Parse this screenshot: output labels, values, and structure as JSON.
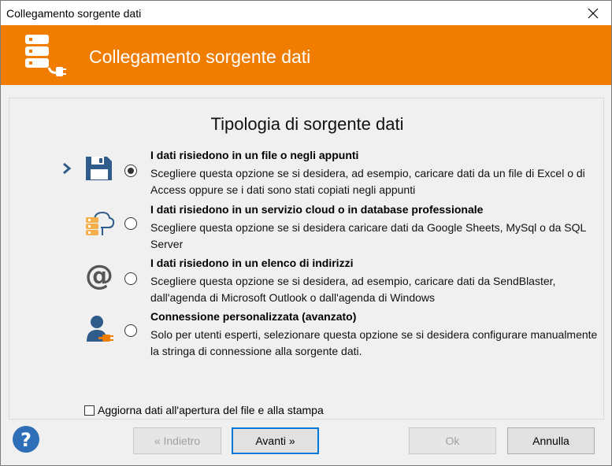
{
  "window": {
    "title": "Collegamento sorgente dati",
    "close_glyph": "✕"
  },
  "banner": {
    "title": "Collegamento sorgente dati",
    "icon": "database-plug-icon",
    "color": "#f07c00"
  },
  "section": {
    "heading": "Tipologia di sorgente dati"
  },
  "options": [
    {
      "title": "I dati risiedono in un file o negli appunti",
      "description": "Scegliere questa opzione se si desidera, ad esempio, caricare dati da un file di Excel o di Access oppure se i dati sono stati copiati negli appunti",
      "icon": "floppy-disk-icon",
      "selected": true
    },
    {
      "title": "I dati risiedono in un servizio cloud o in database professionale",
      "description": "Scegliere questa opzione se si desidera caricare dati da Google Sheets, MySql o da SQL Server",
      "icon": "cloud-database-icon",
      "selected": false
    },
    {
      "title": "I dati risiedono in un elenco di indirizzi",
      "description": "Scegliere questa opzione se si desidera, ad esempio, caricare dati da SendBlaster, dall'agenda di Microsoft Outlook o dall'agenda di Windows",
      "icon": "at-sign-icon",
      "selected": false
    },
    {
      "title": "Connessione personalizzata (avanzato)",
      "description": "Solo per utenti esperti, selezionare questa opzione se si desidera configurare manualmente la stringa di connessione alla sorgente dati.",
      "icon": "user-plug-icon",
      "selected": false
    }
  ],
  "refresh_checkbox": {
    "label": "Aggiorna dati all'apertura del file e alla stampa",
    "checked": false
  },
  "buttons": {
    "back": "« Indietro",
    "next": "Avanti »",
    "ok": "Ok",
    "cancel": "Annulla"
  },
  "colors": {
    "accent_orange": "#f07c00",
    "icon_blue": "#2f5c8a",
    "help_blue": "#2e6fb7"
  }
}
